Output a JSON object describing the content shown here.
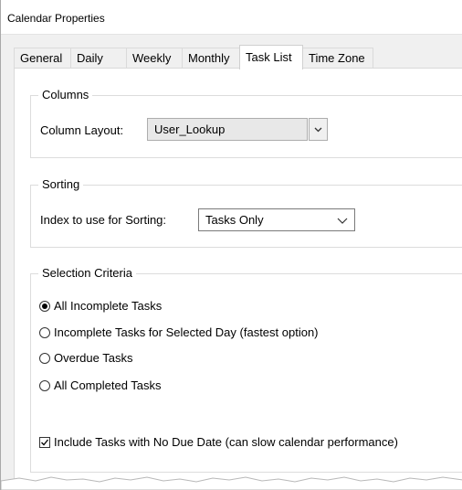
{
  "window": {
    "title": "Calendar Properties"
  },
  "tabs": [
    {
      "label": "General",
      "active": false
    },
    {
      "label": "Daily",
      "active": false
    },
    {
      "label": "Weekly",
      "active": false
    },
    {
      "label": "Monthly",
      "active": false
    },
    {
      "label": "Task List",
      "active": true
    },
    {
      "label": "Time Zone",
      "active": false
    }
  ],
  "columns_group": {
    "label": "Columns",
    "layout_label": "Column Layout:",
    "layout_value": "User_Lookup"
  },
  "sorting_group": {
    "label": "Sorting",
    "index_label": "Index to use for Sorting:",
    "index_value": "Tasks Only"
  },
  "selection_group": {
    "label": "Selection Criteria",
    "options": [
      {
        "label": "All Incomplete Tasks",
        "checked": true
      },
      {
        "label": "Incomplete Tasks for Selected Day (fastest option)",
        "checked": false
      },
      {
        "label": "Overdue Tasks",
        "checked": false
      },
      {
        "label": "All Completed Tasks",
        "checked": false
      }
    ],
    "include_no_due": {
      "label": "Include Tasks with No Due Date (can slow calendar performance)",
      "checked": true
    }
  }
}
